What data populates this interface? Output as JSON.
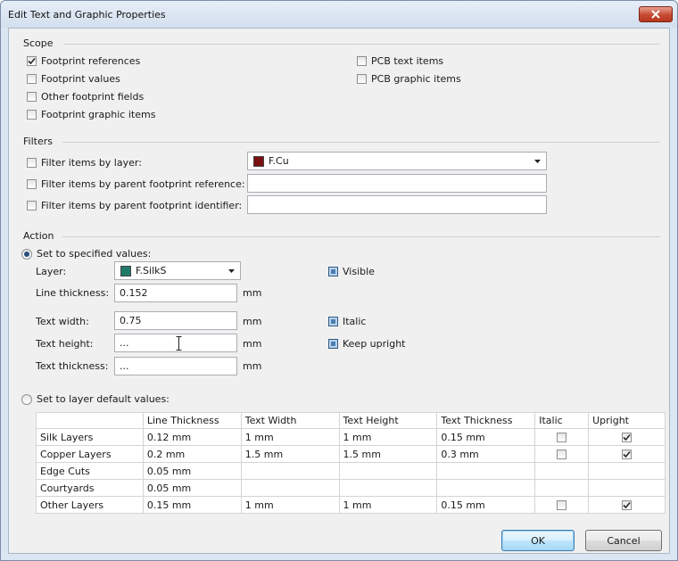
{
  "window": {
    "title": "Edit Text and Graphic Properties"
  },
  "scope": {
    "label": "Scope",
    "footprint_references": {
      "label": "Footprint references",
      "checked": true
    },
    "footprint_values": {
      "label": "Footprint values",
      "checked": false
    },
    "other_footprint_fields": {
      "label": "Other footprint fields",
      "checked": false
    },
    "footprint_graphic_items": {
      "label": "Footprint graphic items",
      "checked": false
    },
    "pcb_text_items": {
      "label": "PCB text items",
      "checked": false
    },
    "pcb_graphic_items": {
      "label": "PCB graphic items",
      "checked": false
    }
  },
  "filters": {
    "label": "Filters",
    "by_layer": {
      "label": "Filter items by layer:",
      "checked": false,
      "value": "F.Cu",
      "swatch": "#7a0f0f"
    },
    "by_reference": {
      "label": "Filter items by parent footprint reference:",
      "checked": false,
      "value": ""
    },
    "by_identifier": {
      "label": "Filter items by parent footprint identifier:",
      "checked": false,
      "value": ""
    }
  },
  "action": {
    "label": "Action",
    "specified": {
      "label": "Set to specified values:",
      "selected": true,
      "layer": {
        "label": "Layer:",
        "value": "F.SilkS",
        "swatch": "#1f7a6a"
      },
      "line_thickness": {
        "label": "Line thickness:",
        "value": "0.152",
        "unit": "mm"
      },
      "text_width": {
        "label": "Text width:",
        "value": "0.75",
        "unit": "mm"
      },
      "text_height": {
        "label": "Text height:",
        "value": "...",
        "unit": "mm"
      },
      "text_thickness": {
        "label": "Text thickness:",
        "value": "...",
        "unit": "mm"
      },
      "visible": {
        "label": "Visible",
        "state": "indeterminate"
      },
      "italic": {
        "label": "Italic",
        "state": "indeterminate"
      },
      "keep_upright": {
        "label": "Keep upright",
        "state": "indeterminate"
      }
    },
    "defaults": {
      "label": "Set to layer default values:",
      "selected": false,
      "columns": [
        "",
        "Line Thickness",
        "Text Width",
        "Text Height",
        "Text Thickness",
        "Italic",
        "Upright"
      ],
      "rows": [
        {
          "name": "Silk Layers",
          "line": "0.12 mm",
          "width": "1 mm",
          "height": "1 mm",
          "thickness": "0.15 mm",
          "italic": false,
          "upright": true
        },
        {
          "name": "Copper Layers",
          "line": "0.2 mm",
          "width": "1.5 mm",
          "height": "1.5 mm",
          "thickness": "0.3 mm",
          "italic": false,
          "upright": true
        },
        {
          "name": "Edge Cuts",
          "line": "0.05 mm",
          "width": "",
          "height": "",
          "thickness": "",
          "italic": null,
          "upright": null
        },
        {
          "name": "Courtyards",
          "line": "0.05 mm",
          "width": "",
          "height": "",
          "thickness": "",
          "italic": null,
          "upright": null
        },
        {
          "name": "Other Layers",
          "line": "0.15 mm",
          "width": "1 mm",
          "height": "1 mm",
          "thickness": "0.15 mm",
          "italic": false,
          "upright": true
        }
      ]
    }
  },
  "buttons": {
    "ok": "OK",
    "cancel": "Cancel"
  }
}
